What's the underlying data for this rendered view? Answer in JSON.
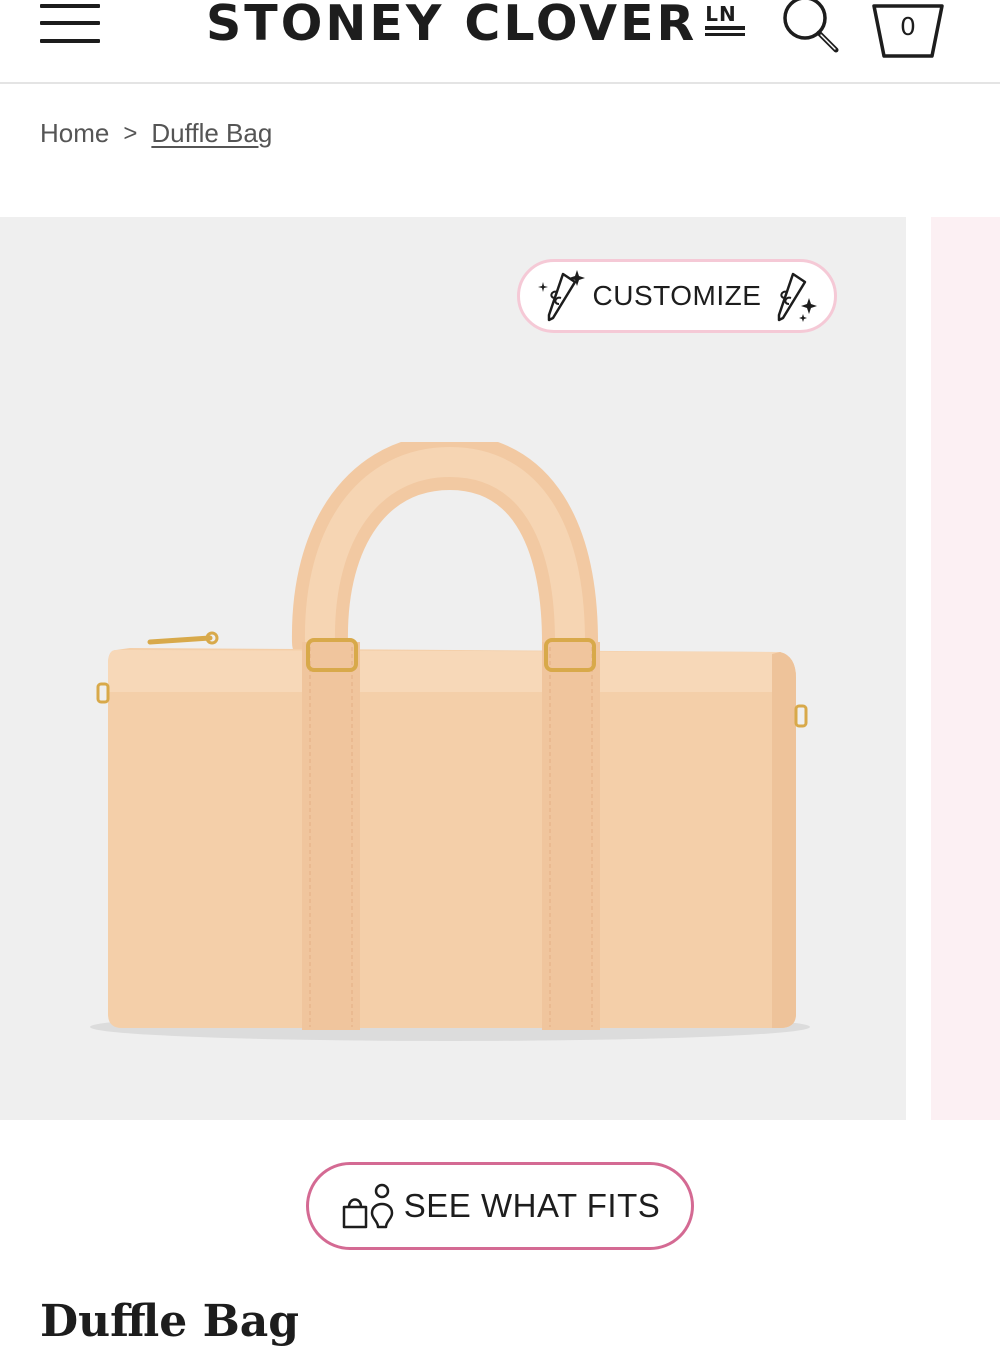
{
  "header": {
    "brand": "STONEY CLOVER",
    "brand_mark": "LN",
    "cart_count": "0"
  },
  "breadcrumb": {
    "home": "Home",
    "separator": ">",
    "current": "Duffle Bag"
  },
  "gallery": {
    "customize_label": "CUSTOMIZE",
    "main_image": "duffle-bag-tan"
  },
  "fits": {
    "label": "SEE WHAT FITS"
  },
  "product": {
    "title": "Duffle Bag"
  },
  "colors": {
    "pink_border": "#d46a93",
    "light_pink_border": "#f5c9d6",
    "bag": "#f4cfa9",
    "gallery_bg": "#efefef"
  },
  "icons": [
    "menu-icon",
    "search-icon",
    "cart-icon",
    "wand-icon",
    "bag-person-icon"
  ]
}
